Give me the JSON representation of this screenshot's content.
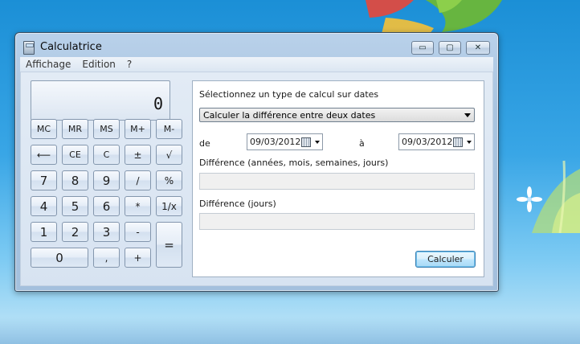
{
  "window": {
    "title": "Calculatrice",
    "buttons": {
      "minimize": "▭",
      "maximize": "▢",
      "close": "✕"
    }
  },
  "menu": [
    "Affichage",
    "Edition",
    "?"
  ],
  "display": {
    "value": "0"
  },
  "keys": [
    {
      "label": "MC",
      "name": "mc-button"
    },
    {
      "label": "MR",
      "name": "mr-button"
    },
    {
      "label": "MS",
      "name": "ms-button"
    },
    {
      "label": "M+",
      "name": "m-plus-button"
    },
    {
      "label": "M-",
      "name": "m-minus-button"
    },
    {
      "label": "⟵",
      "name": "backspace-button"
    },
    {
      "label": "CE",
      "name": "clear-entry-button"
    },
    {
      "label": "C",
      "name": "clear-button"
    },
    {
      "label": "±",
      "name": "negate-button"
    },
    {
      "label": "√",
      "name": "sqrt-button"
    },
    {
      "label": "7",
      "name": "digit-7-button"
    },
    {
      "label": "8",
      "name": "digit-8-button"
    },
    {
      "label": "9",
      "name": "digit-9-button"
    },
    {
      "label": "/",
      "name": "divide-button"
    },
    {
      "label": "%",
      "name": "percent-button"
    },
    {
      "label": "4",
      "name": "digit-4-button"
    },
    {
      "label": "5",
      "name": "digit-5-button"
    },
    {
      "label": "6",
      "name": "digit-6-button"
    },
    {
      "label": "*",
      "name": "multiply-button"
    },
    {
      "label": "1/x",
      "name": "reciprocal-button"
    },
    {
      "label": "1",
      "name": "digit-1-button"
    },
    {
      "label": "2",
      "name": "digit-2-button"
    },
    {
      "label": "3",
      "name": "digit-3-button"
    },
    {
      "label": "-",
      "name": "subtract-button"
    },
    {
      "label": "=",
      "name": "equals-button"
    },
    {
      "label": "0",
      "name": "digit-0-button"
    },
    {
      "label": ",",
      "name": "decimal-button"
    },
    {
      "label": "+",
      "name": "add-button"
    }
  ],
  "date_panel": {
    "heading": "Sélectionnez un type de calcul sur dates",
    "calc_type": "Calculer la différence entre deux dates",
    "from_label": "de",
    "from_date": "09/03/2012",
    "to_label": "à",
    "to_date": "09/03/2012",
    "diff_full_label": "Différence (années, mois, semaines, jours)",
    "diff_full_value": "",
    "diff_days_label": "Différence (jours)",
    "diff_days_value": "",
    "calculate_label": "Calculer"
  },
  "colors": {
    "titlebar": "#b9d1ea",
    "client": "#dce6f2",
    "desktop": "#2a9ae0",
    "accent_button": "#a7d9f5"
  }
}
